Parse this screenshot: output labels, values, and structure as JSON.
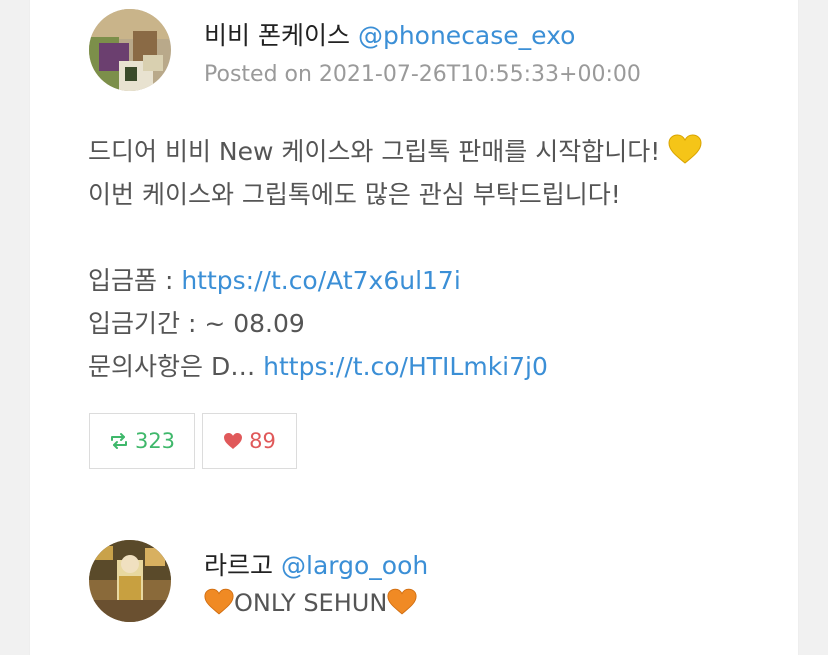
{
  "post1": {
    "display_name": "비비 폰케이스",
    "handle": "@phonecase_exo",
    "posted": "Posted on 2021-07-26T10:55:33+00:00",
    "body": {
      "line1": "드디어 비비 New 케이스와 그립톡 판매를 시작합니다!",
      "line1_emoji": "yellow-heart",
      "line2": "이번 케이스와 그립톡에도 많은 관심 부탁드립니다!",
      "line4_label": "입금폼 : ",
      "line4_link": "https://t.co/At7x6ul17i",
      "line5": "입금기간 : ~ 08.09",
      "line6_label": "문의사항은 D… ",
      "line6_link": "https://t.co/HTILmki7j0"
    },
    "retweets": "323",
    "likes": "89"
  },
  "post2": {
    "display_name": "라르고",
    "handle": "@largo_ooh",
    "bio": "ONLY SEHUN",
    "bio_emoji": "orange-heart"
  },
  "colors": {
    "link": "#3b8fd6",
    "retweet": "#3fb86b",
    "like": "#e0595a",
    "yellow_heart": "#f5c518",
    "orange_heart": "#f08a24"
  }
}
